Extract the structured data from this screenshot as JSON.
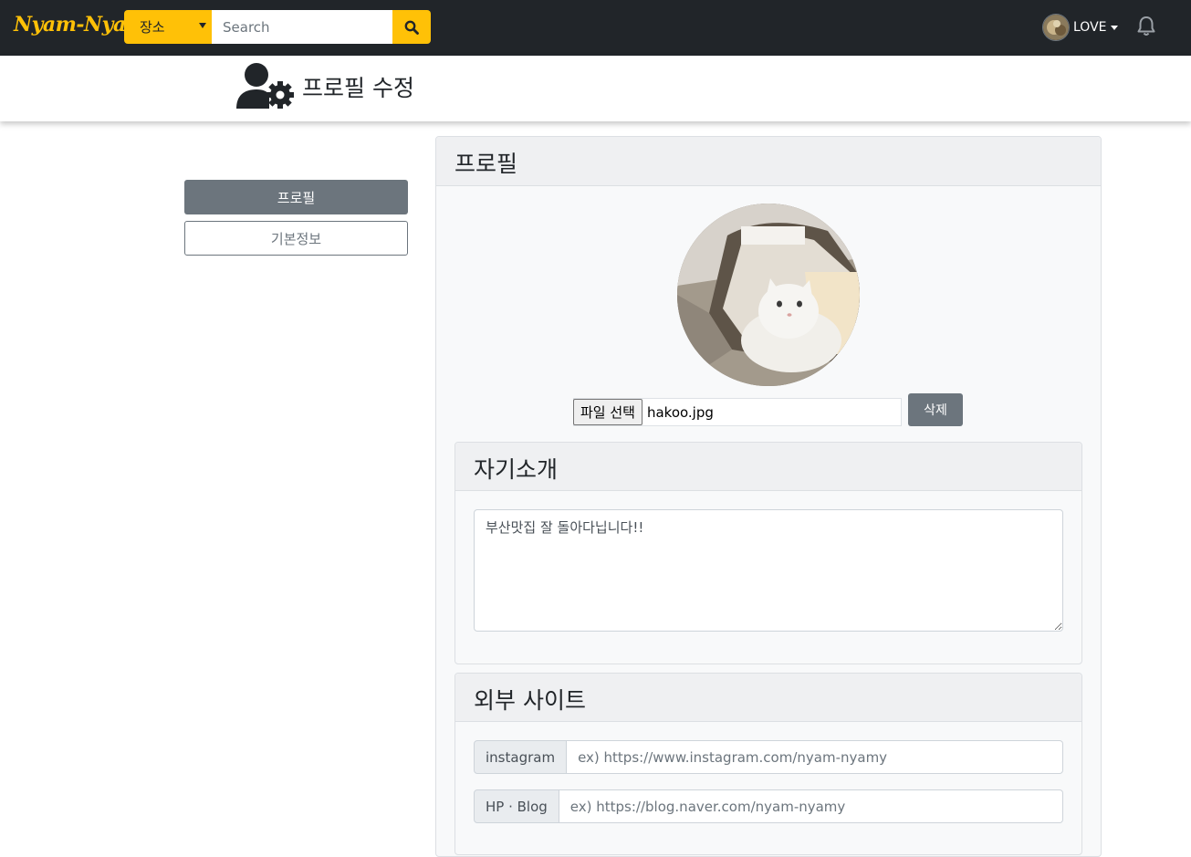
{
  "navbar": {
    "brand": "Nyam-Nyam",
    "place_select": "장소",
    "search_placeholder": "Search",
    "user_name": "LOVE"
  },
  "header": {
    "title": "프로필 수정"
  },
  "sidebar": {
    "items": [
      {
        "label": "프로필",
        "active": true
      },
      {
        "label": "기본정보",
        "active": false
      }
    ]
  },
  "profile": {
    "card_title": "프로필",
    "file_button": "파일 선택",
    "file_name": "hakoo.jpg",
    "delete_button": "삭제"
  },
  "intro": {
    "title": "자기소개",
    "text": "부산맛집 잘 돌아다닙니다!!"
  },
  "external": {
    "title": "외부 사이트",
    "links": [
      {
        "label": "instagram",
        "placeholder": "ex) https://www.instagram.com/nyam-nyamy"
      },
      {
        "label": "HP · Blog",
        "placeholder": "ex) https://blog.naver.com/nyam-nyamy"
      }
    ]
  },
  "colors": {
    "navbar_bg": "#212529",
    "accent": "#ffc107",
    "secondary": "#6c757d"
  },
  "icons": [
    "search-icon",
    "bell-icon",
    "user-gear-icon",
    "caret-down-icon"
  ]
}
